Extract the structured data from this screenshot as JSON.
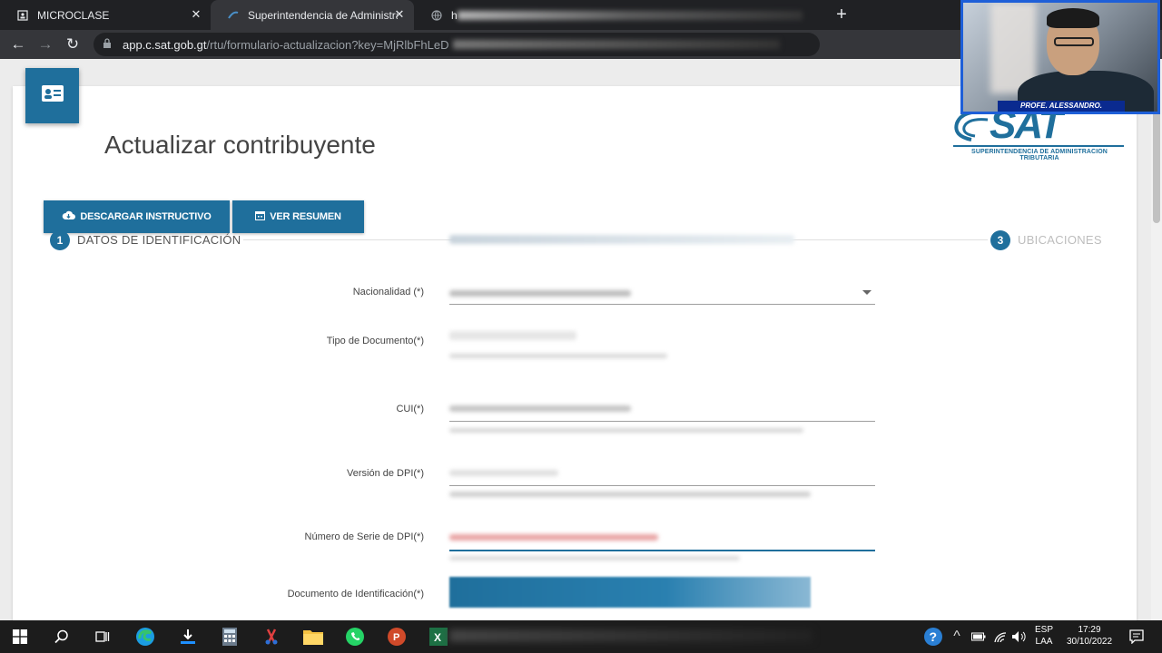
{
  "browser": {
    "tabs": [
      {
        "title": "MICROCLASE",
        "icon": "page-icon"
      },
      {
        "title": "Superintendencia de Administrac",
        "icon": "sat-favicon"
      },
      {
        "title": "h",
        "icon": "globe-icon"
      }
    ],
    "url_host": "app.c.sat.gob.gt",
    "url_path": "/rtu/formulario-actualizacion?key=MjRlbFhLeD"
  },
  "page": {
    "title": "Actualizar contribuyente",
    "buttons": {
      "download": "DESCARGAR INSTRUCTIVO",
      "summary": "VER RESUMEN"
    },
    "steps": [
      {
        "num": "1",
        "label": "DATOS DE IDENTIFICACIÓN",
        "active": true
      },
      {
        "num": "3",
        "label": "UBICACIONES",
        "active": false
      }
    ],
    "fields": [
      {
        "label": "Nacionalidad (*)"
      },
      {
        "label": "Tipo de Documento(*)"
      },
      {
        "label": "CUI(*)"
      },
      {
        "label": "Versión de DPI(*)"
      },
      {
        "label": "Número de Serie de DPI(*)"
      },
      {
        "label": "Documento de Identificación(*)"
      }
    ]
  },
  "logo": {
    "word": "SAT",
    "subtitle": "SUPERINTENDENCIA DE ADMINISTRACION TRIBUTARIA",
    "color": "#1f6f9c"
  },
  "webcam": {
    "caption": "PROFE. ALESSANDRO."
  },
  "taskbar": {
    "lang_top": "ESP",
    "lang_bottom": "LAA",
    "time": "17:29",
    "date": "30/10/2022"
  },
  "colors": {
    "primary": "#1f6f9c",
    "error": "#e57373"
  }
}
